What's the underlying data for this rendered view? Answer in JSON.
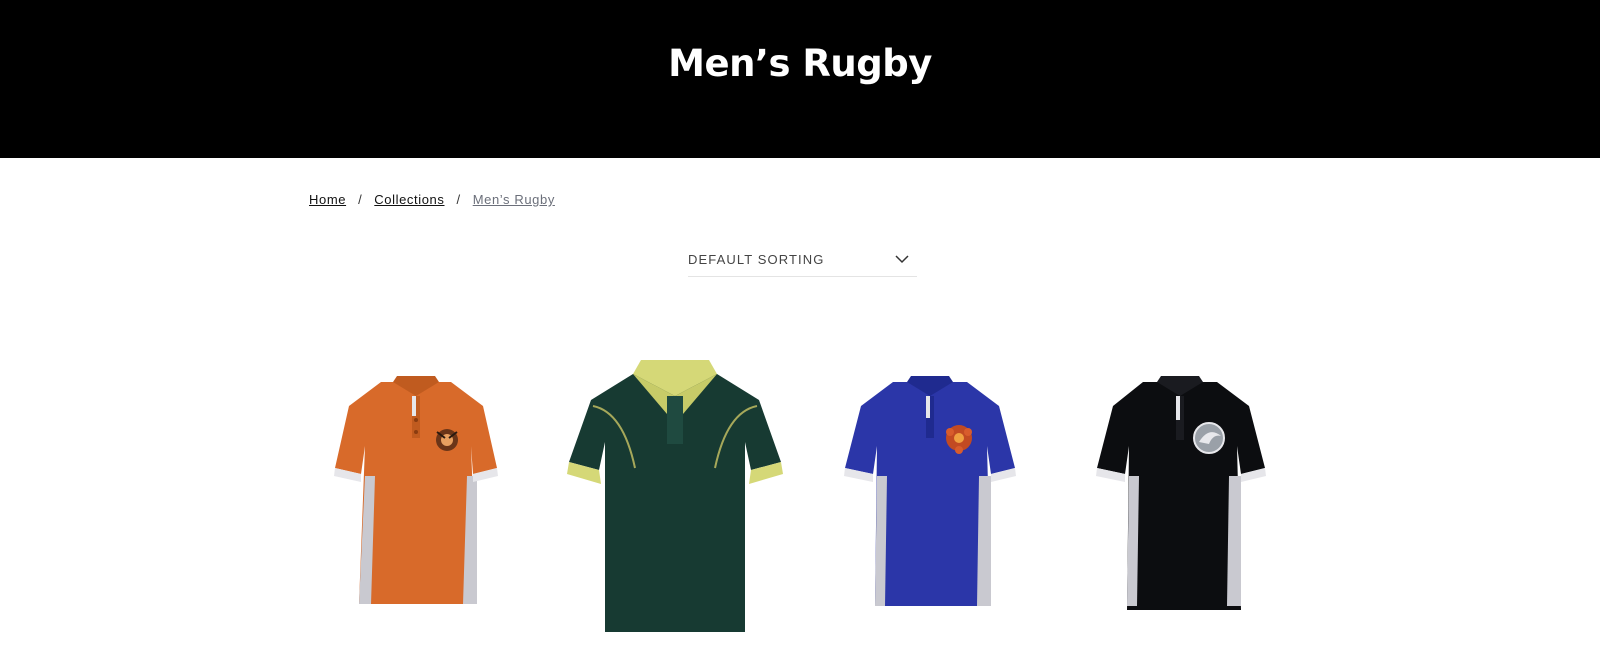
{
  "page": {
    "title": "Men’s Rugby"
  },
  "breadcrumb": {
    "items": [
      "Home",
      "Collections"
    ],
    "separator": "/",
    "current": "Men’s Rugby"
  },
  "sorting": {
    "selected": "DEFAULT SORTING",
    "icon": "chevron-down-icon"
  },
  "products": [
    {
      "icon": "orange-rugby-polo-shirt",
      "body_color": "#d86a2a",
      "panel_color": "#c9c9d0",
      "logo": "tiger"
    },
    {
      "icon": "green-gold-rugby-polo-shirt",
      "body_color": "#173a32",
      "panel_color": "#d5d877",
      "logo": "none"
    },
    {
      "icon": "blue-rugby-polo-shirt",
      "body_color": "#2b36a8",
      "panel_color": "#c9c9d0",
      "logo": "flower"
    },
    {
      "icon": "black-rugby-polo-shirt",
      "body_color": "#0c0d10",
      "panel_color": "#c9c9d0",
      "logo": "shark"
    }
  ]
}
